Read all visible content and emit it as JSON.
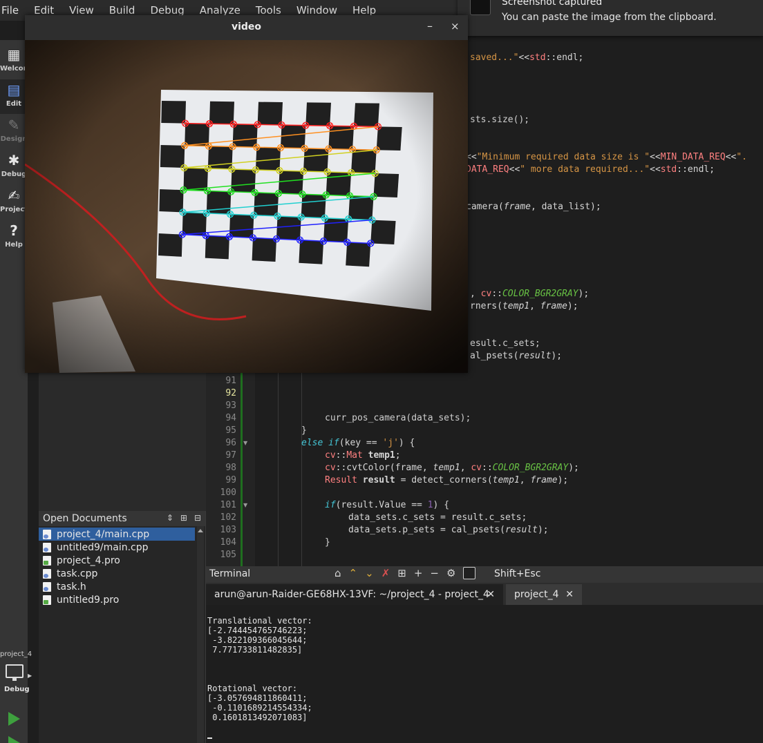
{
  "menu": [
    "File",
    "Edit",
    "View",
    "Build",
    "Debug",
    "Analyze",
    "Tools",
    "Window",
    "Help"
  ],
  "modes": [
    {
      "label": "Welcome",
      "icon": "grid-icon"
    },
    {
      "label": "Edit",
      "icon": "edit-icon"
    },
    {
      "label": "Design",
      "icon": "pencil-icon"
    },
    {
      "label": "Debug",
      "icon": "bug-icon"
    },
    {
      "label": "Projects",
      "icon": "wrench-icon"
    },
    {
      "label": "Help",
      "icon": "help-icon"
    }
  ],
  "kit": {
    "project": "project_4",
    "mode": "Debug"
  },
  "open_docs": {
    "title": "Open Documents",
    "items": [
      "project_4/main.cpp",
      "untitled9/main.cpp",
      "project_4.pro",
      "task.cpp",
      "task.h",
      "untitled9.pro"
    ]
  },
  "editor": {
    "top_fragments": [
      "saved...\"<<std::endl;",
      "sts.size();",
      "<<\"Minimum required data size is \"<<MIN_DATA_REQ<<\".",
      "DATA_REQ<<\" more data required...\"<<std::endl;",
      "camera(frame, data_list);",
      ", cv::COLOR_BGR2GRAY);",
      "rners(temp1, frame);",
      "esult.c_sets;",
      "al_psets(result);"
    ],
    "line_numbers": [
      "91",
      "92",
      "93",
      "94",
      "95",
      "96",
      "97",
      "98",
      "99",
      "100",
      "101",
      "102",
      "103",
      "104",
      "105"
    ],
    "current_line": "92",
    "lines": [
      "",
      "",
      "",
      "curr_pos_camera(data_sets);",
      "}",
      "else if(key == 'j') {",
      "cv::Mat temp1;",
      "cv::cvtColor(frame, temp1, cv::COLOR_BGR2GRAY);",
      "Result result = detect_corners(temp1, frame);",
      "",
      "if(result.Value == 1) {",
      "data_sets.c_sets = result.c_sets;",
      "data_sets.p_sets = cal_psets(result);",
      "}",
      ""
    ]
  },
  "terminal": {
    "title": "Terminal",
    "shortcut": "Shift+Esc",
    "tabs": [
      "arun@arun-Raider-GE68HX-13VF: ~/project_4 - project_4",
      "project_4"
    ],
    "output": "Translational vector:\n[-2.744454765746223;\n -3.822109366045644;\n 7.771733811482835]\n\n\n\nRotational vector:\n[-3.057694811860411;\n -0.1101689214554334;\n 0.1601813492071083]"
  },
  "notification": {
    "title": "Screenshot captured",
    "body": "You can paste the image from the clipboard."
  },
  "video_window": {
    "title": "video",
    "minimize": "–",
    "close": "×"
  },
  "colors": {
    "accent": "#2f5f9e",
    "rows": [
      "#ff2020",
      "#ff9020",
      "#d0d020",
      "#20e020",
      "#20d0d0",
      "#2020ff"
    ]
  }
}
